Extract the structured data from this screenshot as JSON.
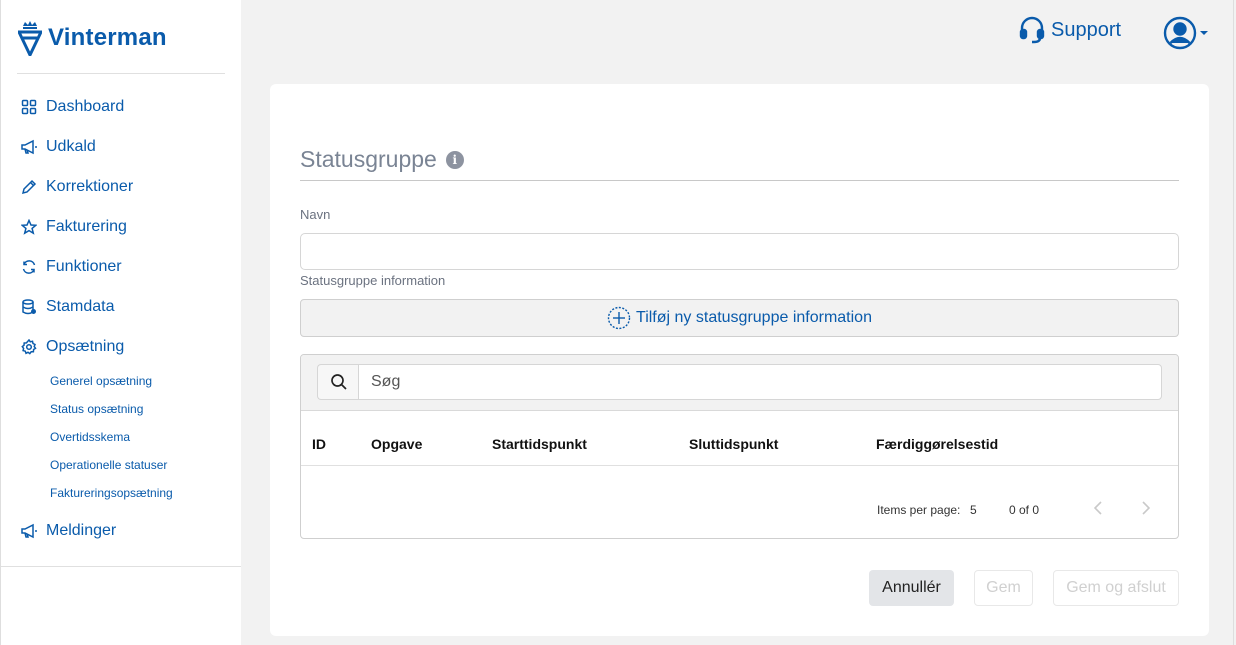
{
  "brand": {
    "name": "Vinterman",
    "color": "#0a5bab"
  },
  "sidebar": {
    "items": [
      {
        "label": "Dashboard",
        "icon": "grid-icon"
      },
      {
        "label": "Udkald",
        "icon": "megaphone-icon"
      },
      {
        "label": "Korrektioner",
        "icon": "pencil-icon"
      },
      {
        "label": "Fakturering",
        "icon": "star-icon"
      },
      {
        "label": "Funktioner",
        "icon": "refresh-icon"
      },
      {
        "label": "Stamdata",
        "icon": "database-icon"
      },
      {
        "label": "Opsætning",
        "icon": "gear-icon"
      }
    ],
    "subitems": [
      "Generel opsætning",
      "Status opsætning",
      "Overtidsskema",
      "Operationelle statuser",
      "Faktureringsopsætning"
    ],
    "last_item": {
      "label": "Meldinger",
      "icon": "megaphone-icon"
    }
  },
  "header": {
    "support_label": "Support",
    "support_icon": "headset-icon",
    "user_icon": "user-circle-icon"
  },
  "form": {
    "title": "Statusgruppe",
    "info_glyph": "i",
    "name_label": "Navn",
    "name_value": "",
    "info_label": "Statusgruppe information",
    "add_button_label": "Tilføj ny statusgruppe information",
    "search_placeholder": "Søg",
    "columns": [
      "ID",
      "Opgave",
      "Starttidspunkt",
      "Sluttidspunkt",
      "Færdiggørelsestid"
    ],
    "rows": [],
    "pager": {
      "items_per_page_label": "Items per page:",
      "items_per_page_value": "5",
      "range": "0 of 0"
    }
  },
  "actions": {
    "cancel": "Annullér",
    "save": "Gem",
    "save_close": "Gem og afslut"
  }
}
